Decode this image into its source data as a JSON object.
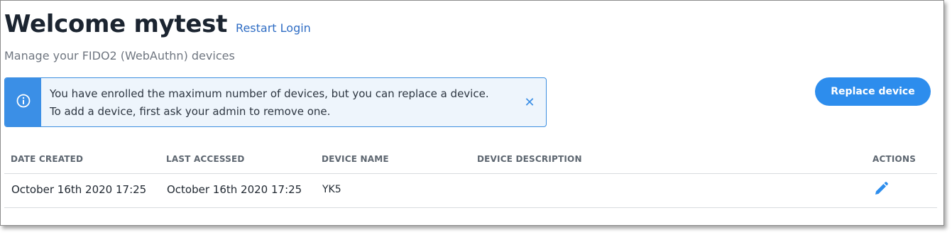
{
  "header": {
    "title": "Welcome mytest",
    "restart_link": "Restart Login",
    "subtitle": "Manage your FIDO2 (WebAuthn) devices"
  },
  "alert": {
    "icon": "info-icon",
    "line1": "You have enrolled the maximum number of devices, but you can replace a device.",
    "line2": "To add a device, first ask your admin to remove one.",
    "close_icon": "close-icon",
    "close_glyph": "✕"
  },
  "actions": {
    "replace_label": "Replace device"
  },
  "table": {
    "columns": [
      "DATE CREATED",
      "LAST ACCESSED",
      "DEVICE NAME",
      "DEVICE DESCRIPTION",
      "ACTIONS"
    ],
    "rows": [
      {
        "date_created": "October 16th 2020 17:25",
        "last_accessed": "October 16th 2020 17:25",
        "device_name": "YK5",
        "device_description": "",
        "action_icon": "pencil-icon"
      }
    ]
  },
  "colors": {
    "primary": "#2d8ded",
    "link": "#2f6dc4",
    "title": "#1b2430"
  }
}
